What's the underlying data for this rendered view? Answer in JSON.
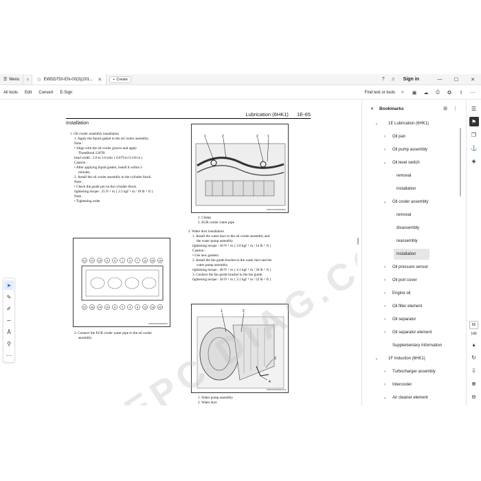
{
  "titlebar": {
    "menu_label": "Menu",
    "tab_title": "EWDD750-EN-00(3)(201...",
    "create_label": "Create",
    "signin_label": "Sign in"
  },
  "toolbar": {
    "items": [
      "All tools",
      "Edit",
      "Convert",
      "E-Sign"
    ],
    "find_label": "Find text or tools"
  },
  "document": {
    "header_title": "Lubrication (6HK1)",
    "header_page": "1E-65",
    "section_title": "installation",
    "left_column": [
      {
        "text": "1.   Oil cooler assembly  installation",
        "indent": 1
      },
      {
        "text": "1.   Apply the liquid gasket to the oil cooler assembly.",
        "indent": 2
      },
      {
        "text": "Note :",
        "indent": 2
      },
      {
        "text": "•   Align with the oil cooler groove and apply",
        "indent": 2
      },
      {
        "text": "ThreeBond 1207B.",
        "indent": 3
      },
      {
        "text": "bead width :  2.0 to 3.0 mm { 0.079 to 0.118 in }",
        "indent": 2
      },
      {
        "text": "Caution :",
        "indent": 2
      },
      {
        "text": "•   After applying liquid gasket, install it within 5",
        "indent": 2
      },
      {
        "text": "minutes.",
        "indent": 3
      },
      {
        "text": "2.   Install the oil cooler assembly to the cylinder block.",
        "indent": 2
      },
      {
        "text": "Note :",
        "indent": 2
      },
      {
        "text": "•   Check the guide pin on the cylinder block.",
        "indent": 2
      },
      {
        "text": "tightening torque :  25 N・m { 2.5 kgf・m / 18 lb・ft }",
        "indent": 2
      },
      {
        "text": "Note :",
        "indent": 2
      },
      {
        "text": "•   Tightening order",
        "indent": 2
      }
    ],
    "left_fig_code": "RW6HXSHW000001",
    "left_bottom": [
      {
        "text": "3.   Connect the EGR cooler water pipe to the oil cooler",
        "indent": 2
      },
      {
        "text": "assembly.",
        "indent": 3
      }
    ],
    "right_fig1_code": "RW6HXSHW002001",
    "right_fig1_legend": [
      "1.   Clamp",
      "2.   EGR cooler water pipe"
    ],
    "right_column": [
      {
        "text": "2.   Water duct  installation",
        "indent": 1
      },
      {
        "text": "1.   Install the water duct to the oil cooler assembly and",
        "indent": 2
      },
      {
        "text": "the water pump assembly.",
        "indent": 3
      },
      {
        "text": "tightening torque :  20 N・m { 2.0 kgf・m / 14 lb・ft }",
        "indent": 2
      },
      {
        "text": "Caution :",
        "indent": 2
      },
      {
        "text": "•   Use new gaskets.",
        "indent": 2
      },
      {
        "text": "2.   Install the fan guide bracket to the water duct and the",
        "indent": 2
      },
      {
        "text": "water pump assembly.",
        "indent": 3
      },
      {
        "text": "tightening torque :  40 N・m { 4.1 kgf・m / 30 lb・ft }",
        "indent": 2
      },
      {
        "text": "3.   Connect the fan guide bracket to the fan guide.",
        "indent": 2
      },
      {
        "text": "tightening torque :  30 N・m { 3.1 kgf・m / 22 lb・ft }",
        "indent": 2
      }
    ],
    "right_fig2_code": "RW6HXSHW002101",
    "right_fig2_legend": [
      "1.   Water pump assembly",
      "2.   Water duct"
    ],
    "tightening_numbers": [
      "21",
      "17",
      "13",
      "9",
      "5",
      "1",
      "3",
      "7",
      "11",
      "15",
      "19",
      "22",
      "18",
      "14",
      "10",
      "6",
      "2",
      "4",
      "8",
      "12",
      "16",
      "20"
    ],
    "fig_callouts": [
      "1",
      "2",
      "2",
      "1"
    ],
    "fig2_callouts": [
      "1",
      "2",
      "3",
      "4"
    ],
    "watermark": "EPC DIAG.COM"
  },
  "bookmarks": {
    "title": "Bookmarks",
    "items": [
      {
        "label": "1E Lubrication (6HK1)",
        "level": 0,
        "chevron": "down",
        "selected": false
      },
      {
        "label": "Oil pan",
        "level": 1,
        "chevron": "right",
        "selected": false
      },
      {
        "label": "Oil pump assembly",
        "level": 1,
        "chevron": "right",
        "selected": false
      },
      {
        "label": "Oil level switch",
        "level": 1,
        "chevron": "down",
        "selected": false
      },
      {
        "label": "removal",
        "level": 2,
        "chevron": "",
        "selected": false
      },
      {
        "label": "installation",
        "level": 2,
        "chevron": "",
        "selected": false
      },
      {
        "label": "Oil cooler assembly",
        "level": 1,
        "chevron": "down",
        "selected": false
      },
      {
        "label": "removal",
        "level": 2,
        "chevron": "",
        "selected": false
      },
      {
        "label": "disassembly",
        "level": 2,
        "chevron": "",
        "selected": false
      },
      {
        "label": "reassembly",
        "level": 2,
        "chevron": "",
        "selected": false
      },
      {
        "label": "installation",
        "level": 2,
        "chevron": "",
        "selected": true
      },
      {
        "label": "Oil pressure sensor",
        "level": 1,
        "chevron": "right",
        "selected": false
      },
      {
        "label": "Oil port cover",
        "level": 1,
        "chevron": "right",
        "selected": false
      },
      {
        "label": "Engine oil",
        "level": 1,
        "chevron": "right",
        "selected": false
      },
      {
        "label": "Oil filter element",
        "level": 1,
        "chevron": "right",
        "selected": false
      },
      {
        "label": "Oil separator",
        "level": 1,
        "chevron": "right",
        "selected": false
      },
      {
        "label": "Oil separator element",
        "level": 1,
        "chevron": "right",
        "selected": false
      },
      {
        "label": "Supplementary Information",
        "level": 1,
        "chevron": "",
        "selected": false
      },
      {
        "label": "1F Induction (6HK1)",
        "level": 0,
        "chevron": "down",
        "selected": false
      },
      {
        "label": "Turbocharger assembly",
        "level": 1,
        "chevron": "right",
        "selected": false
      },
      {
        "label": "Intercooler",
        "level": 1,
        "chevron": "right",
        "selected": false
      },
      {
        "label": "Air cleaner element",
        "level": 1,
        "chevron": "down",
        "selected": false
      }
    ]
  },
  "rail": {
    "current_page": "65",
    "total_pages": "140"
  }
}
